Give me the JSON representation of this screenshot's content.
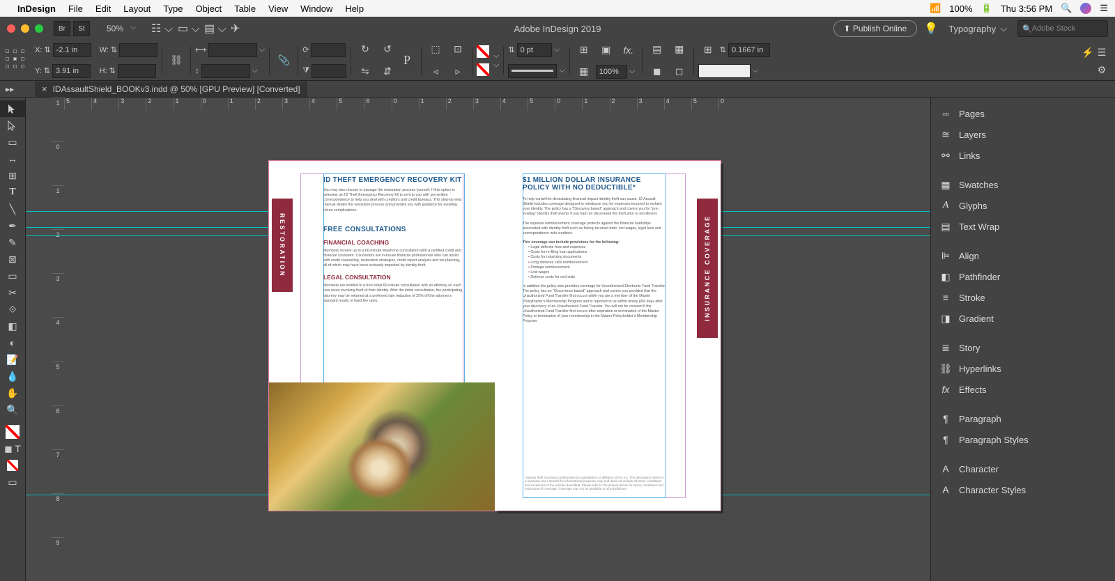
{
  "mac_menu": {
    "app": "InDesign",
    "items": [
      "File",
      "Edit",
      "Layout",
      "Type",
      "Object",
      "Table",
      "View",
      "Window",
      "Help"
    ],
    "battery": "100%",
    "time": "Thu 3:56 PM"
  },
  "app_bar": {
    "zoom": "50%",
    "title": "Adobe InDesign 2019",
    "publish": "Publish Online",
    "workspace": "Typography",
    "search_placeholder": "Adobe Stock"
  },
  "ctrl": {
    "x_label": "X:",
    "x": "-2.1 in",
    "y_label": "Y:",
    "y": "3.91 in",
    "w_label": "W:",
    "w": "",
    "h_label": "H:",
    "h": "",
    "stroke_pt": "0 pt",
    "opacity": "100%",
    "indent": "0.1667 in"
  },
  "tab": {
    "name": "IDAssaultShield_BOOKv3.indd @ 50% [GPU Preview] [Converted]"
  },
  "ruler_h": [
    "5",
    "4",
    "3",
    "2",
    "1",
    "0",
    "1",
    "2",
    "3",
    "4",
    "5",
    "6",
    "0",
    "1",
    "2",
    "3",
    "4",
    "5",
    "0",
    "1",
    "2",
    "3",
    "4",
    "5",
    "0"
  ],
  "ruler_v": [
    "1",
    "0",
    "1",
    "2",
    "3",
    "4",
    "5",
    "6",
    "7",
    "8",
    "9"
  ],
  "panels": [
    "Pages",
    "Layers",
    "Links",
    "Swatches",
    "Glyphs",
    "Text Wrap",
    "Align",
    "Pathfinder",
    "Stroke",
    "Gradient",
    "Story",
    "Hyperlinks",
    "Effects",
    "Paragraph",
    "Paragraph Styles",
    "Character",
    "Character Styles"
  ],
  "doc": {
    "left_tab": "RESTORATION",
    "right_tab": "INSURANCE COVERAGE",
    "left": {
      "h1": "ID THEFT EMERGENCY RECOVERY KIT",
      "p1": "You may also choose to manage the restoration process yourself. If this option is selected, an ID Theft Emergency Recovery Kit is sent to you with pre-written correspondence to help you deal with creditors and credit bureaus. This step-by-step manual details the resolution process and provides you with guidance for avoiding future complications.",
      "h2": "FREE CONSULTATIONS",
      "h3": "FINANCIAL COACHING",
      "p2": "Members receive up to a 60-minute telephone consultation with a certified credit and financial counselor. Counselors are in-house financial professionals who can assist with credit counseling, restoration strategies, credit report analysis and tax planning, all of which may have been seriously impacted by identity theft.",
      "h4": "LEGAL CONSULTATION",
      "p3": "Members are entitled to a free initial 60-minute consultation with an attorney on each new issue involving theft of their identity. After the initial consultation, the participating attorney may be retained at a preferred rate reduction of 25% off the attorney's standard hourly or fixed fee rates."
    },
    "right": {
      "h1": "$1 MILLION DOLLAR INSURANCE POLICY WITH NO DEDUCTIBLE*",
      "p1": "To help curtail the devastating financial impact identity theft can cause, ID Assault Shield includes coverage designed to reimburse you for expenses incurred to reclaim your identity. The policy has a \"Discovery based\" approach and covers you for \"pre-existing\" identity theft events if you had not discovered the theft prior to enrollment.",
      "p2": "The expense reimbursement coverage protects against the financial hardships associated with identity theft such as falsely incurred debt, lost wages, legal fees and correspondence with creditors.",
      "list_h": "This coverage can include provisions for the following:",
      "list": [
        "Legal defense fees and expenses",
        "Costs for re-filing loan applications",
        "Costs for notarizing documents",
        "Long distance calls reimbursement",
        "Postage reimbursement",
        "Lost wages",
        "Defense costs for civil suits"
      ],
      "p3": "In addition the policy also provides coverage for Unauthorized Electronic Fund Transfer. The policy has an \"Occurrence based\" approach and covers you provided that the Unauthorized Fund Transfer first occurs while you are a member of the Master Policyholder's Membership Program and is reported to us within ninety (90) days after your discovery of an Unauthorized Fund Transfer. You will not be covered if the Unauthorized Fund Transfer first occurs after expiration or termination of the Master Policy or termination of your membership in the Master Policyholder's Membership Program.",
      "foot": "*Identity theft insurance underwritten by subsidiaries or affiliates of AIG Inc. The description herein is a summary and intended for informational purposes only and does not include all terms, conditions and exclusions of the policies described. Please refer to the actual policies for terms, conditions and exclusions of coverage. Coverage may not be available in all jurisdictions."
    }
  }
}
